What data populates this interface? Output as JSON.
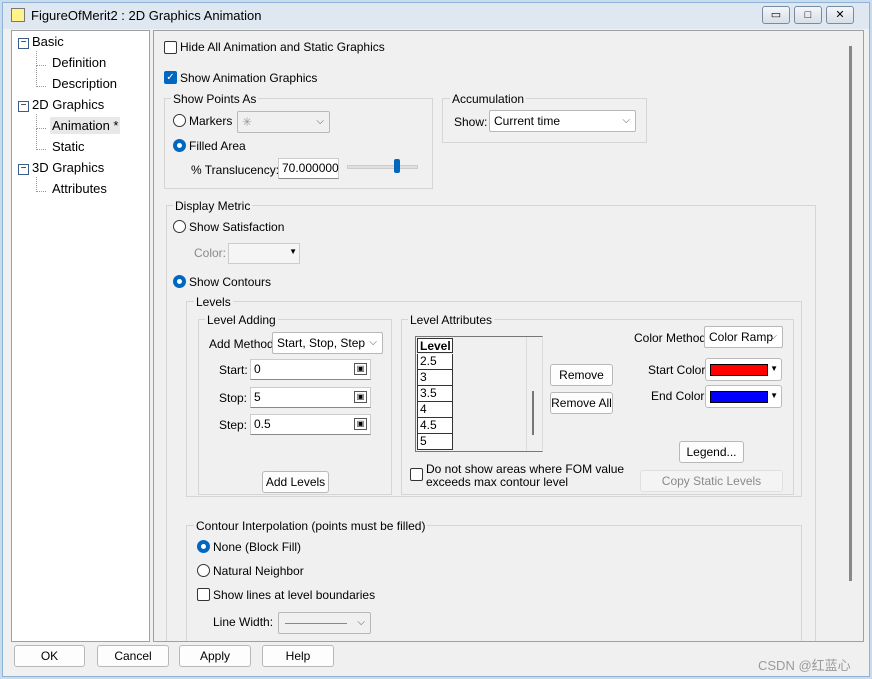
{
  "window": {
    "title": "FigureOfMerit2 : 2D Graphics Animation",
    "minimize": "▭",
    "maximize": "□",
    "close": "✕"
  },
  "tree": [
    {
      "label": "Basic",
      "expander": "−"
    },
    {
      "label": "Definition"
    },
    {
      "label": "Description"
    },
    {
      "label": "2D Graphics",
      "expander": "−"
    },
    {
      "label": "Animation *"
    },
    {
      "label": "Static"
    },
    {
      "label": "3D Graphics",
      "expander": "−"
    },
    {
      "label": "Attributes"
    }
  ],
  "main": {
    "hide_all": "Hide All Animation and Static Graphics",
    "show_anim": "Show Animation Graphics",
    "points_group": "Show Points As",
    "markers": "Markers",
    "marker_symbol": "✳",
    "filled_area": "Filled Area",
    "translucency_label": "% Translucency:",
    "translucency_value": "70.000000",
    "translucency_slider_percent": 70,
    "accum_group": "Accumulation",
    "show_label": "Show:",
    "show_value": "Current time",
    "metric_group": "Display Metric",
    "show_satisfaction": "Show Satisfaction",
    "color_label": "Color:",
    "show_contours": "Show Contours",
    "levels_group": "Levels",
    "adding_group": "Level Adding",
    "add_method_label": "Add Method:",
    "add_method_value": "Start, Stop, Step",
    "start_label": "Start:",
    "start_value": "0",
    "stop_label": "Stop:",
    "stop_value": "5",
    "step_label": "Step:",
    "step_value": "0.5",
    "add_levels": "Add Levels",
    "attr_group": "Level Attributes",
    "level_header": "Level",
    "levels": [
      "2.5",
      "3",
      "3.5",
      "4",
      "4.5",
      "5"
    ],
    "remove": "Remove",
    "remove_all": "Remove All",
    "color_method_label": "Color Method:",
    "color_method_value": "Color Ramp",
    "start_color_label": "Start Color:",
    "start_color": "#ff0000",
    "end_color_label": "End Color:",
    "end_color": "#0000ff",
    "legend": "Legend...",
    "copy_static": "Copy Static Levels",
    "no_show_line1": "Do not show areas where FOM value",
    "no_show_line2": "exceeds max contour level",
    "interp_group": "Contour Interpolation (points must be filled)",
    "none_block": "None (Block Fill)",
    "natural": "Natural Neighbor",
    "show_lines": "Show lines at level boundaries",
    "line_width_label": "Line Width:"
  },
  "footer": {
    "ok": "OK",
    "cancel": "Cancel",
    "apply": "Apply",
    "help": "Help",
    "watermark": "CSDN @红蓝心"
  }
}
